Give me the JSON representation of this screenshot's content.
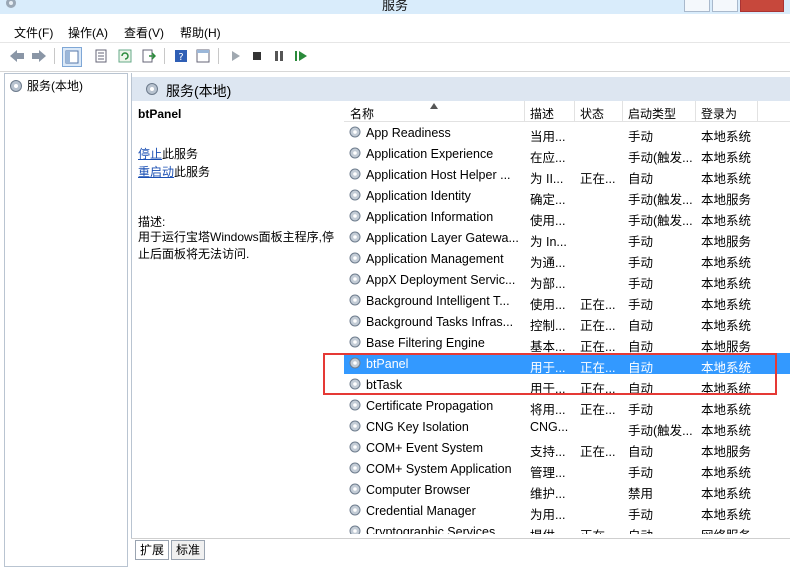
{
  "window": {
    "title": "服务"
  },
  "menu": {
    "items": [
      "文件(F)",
      "操作(A)",
      "查看(V)",
      "帮助(H)"
    ]
  },
  "tree": {
    "root": "服务(本地)"
  },
  "main": {
    "header": "服务(本地)"
  },
  "details": {
    "service_name": "btPanel",
    "stop_link": "停止",
    "stop_suffix": "此服务",
    "restart_link": "重启动",
    "restart_suffix": "此服务",
    "desc_label": "描述:",
    "desc_text": "用于运行宝塔Windows面板主程序,停止后面板将无法访问."
  },
  "list": {
    "columns": [
      "名称",
      "描述",
      "状态",
      "启动类型",
      "登录为"
    ],
    "rows": [
      [
        "App Readiness",
        "当用...",
        "",
        "手动",
        "本地系统"
      ],
      [
        "Application Experience",
        "在应...",
        "",
        "手动(触发...",
        "本地系统"
      ],
      [
        "Application Host Helper ...",
        "为 II...",
        "正在...",
        "自动",
        "本地系统"
      ],
      [
        "Application Identity",
        "确定...",
        "",
        "手动(触发...",
        "本地服务"
      ],
      [
        "Application Information",
        "使用...",
        "",
        "手动(触发...",
        "本地系统"
      ],
      [
        "Application Layer Gatewa...",
        "为 In...",
        "",
        "手动",
        "本地服务"
      ],
      [
        "Application Management",
        "为通...",
        "",
        "手动",
        "本地系统"
      ],
      [
        "AppX Deployment Servic...",
        "为部...",
        "",
        "手动",
        "本地系统"
      ],
      [
        "Background Intelligent T...",
        "使用...",
        "正在...",
        "手动",
        "本地系统"
      ],
      [
        "Background Tasks Infras...",
        "控制...",
        "正在...",
        "自动",
        "本地系统"
      ],
      [
        "Base Filtering Engine",
        "基本...",
        "正在...",
        "自动",
        "本地服务"
      ],
      [
        "btPanel",
        "用于...",
        "正在...",
        "自动",
        "本地系统"
      ],
      [
        "btTask",
        "用于...",
        "正在...",
        "自动",
        "本地系统"
      ],
      [
        "Certificate Propagation",
        "将用...",
        "正在...",
        "手动",
        "本地系统"
      ],
      [
        "CNG Key Isolation",
        "CNG...",
        "",
        "手动(触发...",
        "本地系统"
      ],
      [
        "COM+ Event System",
        "支持...",
        "正在...",
        "自动",
        "本地服务"
      ],
      [
        "COM+ System Application",
        "管理...",
        "",
        "手动",
        "本地系统"
      ],
      [
        "Computer Browser",
        "维护...",
        "",
        "禁用",
        "本地系统"
      ],
      [
        "Credential Manager",
        "为用...",
        "",
        "手动",
        "本地系统"
      ],
      [
        "Cryptographic Services",
        "提供...",
        "正在...",
        "自动",
        "网络服务"
      ]
    ],
    "selected_index": 11
  },
  "tabs": [
    "扩展",
    "标准"
  ]
}
